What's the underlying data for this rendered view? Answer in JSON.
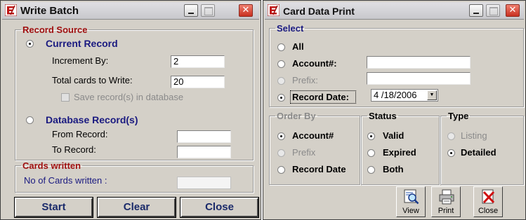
{
  "write_batch": {
    "title": "Write Batch",
    "record_source": {
      "legend": "Record Source",
      "current_record_label": "Current Record",
      "increment_by_label": "Increment By:",
      "increment_by_value": "2",
      "total_cards_label": "Total cards to Write:",
      "total_cards_value": "20",
      "save_records_label": "Save record(s) in database",
      "database_records_label": "Database Record(s)",
      "from_record_label": "From Record:",
      "from_record_value": "",
      "to_record_label": "To Record:",
      "to_record_value": ""
    },
    "cards_written": {
      "legend": "Cards written",
      "count_label": "No of Cards written :",
      "count_value": ""
    },
    "buttons": {
      "start": "Start",
      "clear": "Clear",
      "close": "Close"
    }
  },
  "card_data_print": {
    "title": "Card Data Print",
    "select": {
      "legend": "Select",
      "all_label": "All",
      "account_label": "Account#:",
      "account_value": "",
      "prefix_label": "Prefix:",
      "prefix_value": "",
      "record_date_label": "Record Date:",
      "record_date_value": "4 /18/2006"
    },
    "order_by": {
      "legend": "Order By",
      "account": "Account#",
      "prefix": "Prefix",
      "record_date": "Record Date"
    },
    "status": {
      "legend": "Status",
      "valid": "Valid",
      "expired": "Expired",
      "both": "Both"
    },
    "type": {
      "legend": "Type",
      "listing": "Listing",
      "detailed": "Detailed"
    },
    "toolbar": {
      "view": "View",
      "print": "Print",
      "close": "Close"
    }
  },
  "colors": {
    "accent_red": "#a01010",
    "label_navy": "#1a1a80",
    "window_bg": "#d4d0c8"
  },
  "icons": [
    "app-logo-icon",
    "minimize-icon",
    "maximize-icon",
    "close-icon",
    "view-magnifier-icon",
    "printer-icon",
    "close-x-icon"
  ]
}
